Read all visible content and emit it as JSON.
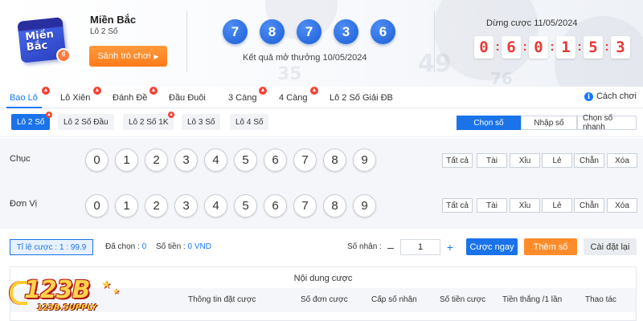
{
  "header": {
    "logo_text": "Miền Bắc",
    "region_name": "Miền Bắc",
    "region_sub": "Lô 2 Số",
    "lobby_button": "Sảnh trò chơi",
    "results": [
      "7",
      "8",
      "7",
      "3",
      "6"
    ],
    "result_caption": "Kết quả mở thưởng 10/05/2024",
    "deadline": "Dừng cược 11/05/2024",
    "timer_digits": [
      "0",
      "6",
      "0",
      "1",
      "5",
      "3"
    ],
    "timer_separator": ":"
  },
  "tabs": [
    "Bao Lô",
    "Lô Xiên",
    "Đánh Đề",
    "Đầu Đuôi",
    "3 Càng",
    "4 Càng",
    "Lô 2 Số Giải ĐB"
  ],
  "guide_label": "Cách chơi",
  "subtabs": [
    "Lô 2 Số",
    "Lô 2 Số Đầu",
    "Lô 2 Số 1K",
    "Lô 3 Số",
    "Lô 4 Số"
  ],
  "modes": [
    "Chọn số",
    "Nhập số",
    "Chọn số nhanh"
  ],
  "rows": [
    {
      "label": "Chục",
      "numbers": [
        "0",
        "1",
        "2",
        "3",
        "4",
        "5",
        "6",
        "7",
        "8",
        "9"
      ]
    },
    {
      "label": "Đơn Vị",
      "numbers": [
        "0",
        "1",
        "2",
        "3",
        "4",
        "5",
        "6",
        "7",
        "8",
        "9"
      ]
    }
  ],
  "quick_buttons": [
    "Tất cả",
    "Tài",
    "Xỉu",
    "Lẻ",
    "Chẵn",
    "Xóa"
  ],
  "controls": {
    "odds": "Tỉ lệ cược : 1 : 99.9",
    "selected_label": "Đã chọn :",
    "selected_value": "0",
    "amount_label": "Số tiền :",
    "amount_value": "0 VND",
    "multiplier_label": "Số nhân :",
    "minus": "–",
    "multiplier_value": "1",
    "plus": "+",
    "bet_now": "Cược ngay",
    "add_number": "Thêm số",
    "reset": "Cài đặt lại"
  },
  "table": {
    "title": "Nội dung cược",
    "columns": [
      "Thông tin đặt cược",
      "Số đơn cược",
      "Cấp số nhân",
      "Số tiền cược",
      "Tiền thắng /1 lần",
      "Thao tác"
    ]
  },
  "watermark": {
    "brand": "123B",
    "sub": "123B.SUPPLY"
  },
  "colors": {
    "primary": "#1a73e8",
    "orange": "#ff8c2a",
    "timer_red": "#e53935",
    "hot": "#f44336"
  }
}
